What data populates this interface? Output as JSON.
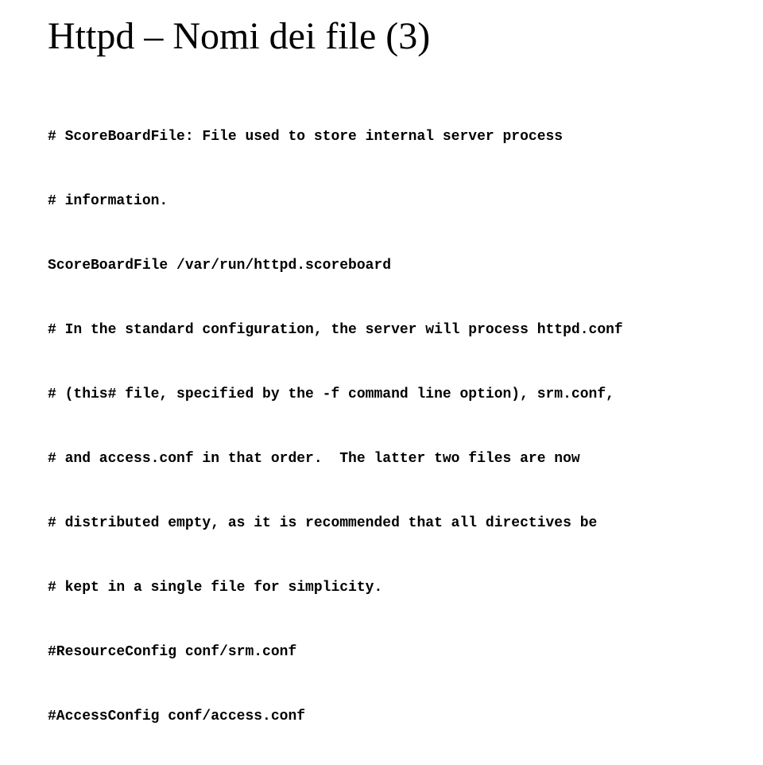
{
  "title": "Httpd – Nomi dei file (3)",
  "lines": {
    "l1": "# ScoreBoardFile: File used to store internal server process",
    "l2": "# information.",
    "l3": "ScoreBoardFile /var/run/httpd.scoreboard",
    "l4": "# In the standard configuration, the server will process httpd.conf",
    "l5": "# (this# file, specified by the -f command line option), srm.conf,",
    "l6": "# and access.conf in that order.  The latter two files are now",
    "l7": "# distributed empty, as it is recommended that all directives be",
    "l8": "# kept in a single file for simplicity.",
    "l9": "#ResourceConfig conf/srm.conf",
    "l10": "#AccessConfig conf/access.conf"
  }
}
